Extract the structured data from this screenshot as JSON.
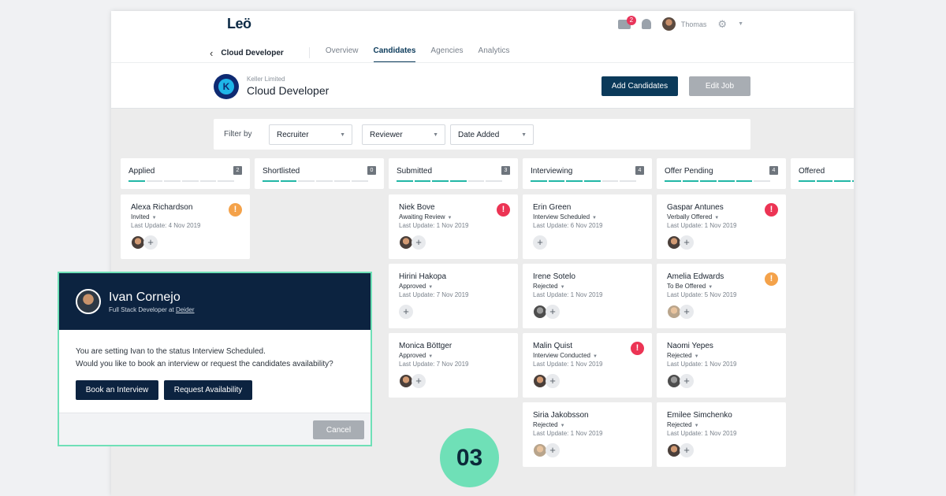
{
  "app": {
    "logo": "Leö",
    "mail_badge": "2",
    "user_name": "Thomas"
  },
  "nav": {
    "job": "Cloud Developer",
    "tabs": [
      "Overview",
      "Candidates",
      "Agencies",
      "Analytics"
    ],
    "active_tab": "Candidates"
  },
  "job": {
    "company_initial": "K",
    "company": "Keller Limited",
    "title": "Cloud Developer",
    "add_label": "Add Candidates",
    "edit_label": "Edit Job"
  },
  "filter": {
    "label": "Filter by",
    "selects": [
      "Recruiter",
      "Reviewer",
      "Date Added"
    ]
  },
  "columns": [
    {
      "title": "Applied",
      "count": "2",
      "progress": 0.1
    },
    {
      "title": "Shortlisted",
      "count": "0",
      "progress": 0.3
    },
    {
      "title": "Submitted",
      "count": "3",
      "progress": 0.6
    },
    {
      "title": "Interviewing",
      "count": "4",
      "progress": 0.6
    },
    {
      "title": "Offer Pending",
      "count": "4",
      "progress": 0.8
    },
    {
      "title": "Offered",
      "count": "",
      "progress": 0.8
    }
  ],
  "cards": {
    "applied": [
      {
        "name": "Alexa Richardson",
        "status": "Invited",
        "update": "Last Update: 4 Nov 2019",
        "alert": "!"
      }
    ],
    "submitted": [
      {
        "name": "Niek Bove",
        "status": "Awaiting Review",
        "update": "Last Update: 1 Nov 2019",
        "alert": "!"
      },
      {
        "name": "Hirini Hakopa",
        "status": "Approved",
        "update": "Last Update: 7 Nov 2019"
      },
      {
        "name": "Monica Böttger",
        "status": "Approved",
        "update": "Last Update: 7 Nov 2019"
      }
    ],
    "interviewing": [
      {
        "name": "Erin Green",
        "status": "Interview Scheduled",
        "update": "Last Update: 6 Nov 2019"
      },
      {
        "name": "Irene Sotelo",
        "status": "Rejected",
        "update": "Last Update: 1 Nov 2019"
      },
      {
        "name": "Malin Quist",
        "status": "Interview Conducted",
        "update": "Last Update: 1 Nov 2019",
        "alert": "!"
      },
      {
        "name": "Siria Jakobsson",
        "status": "Rejected",
        "update": "Last Update: 1 Nov 2019"
      }
    ],
    "offer_pending": [
      {
        "name": "Gaspar Antunes",
        "status": "Verbally Offered",
        "update": "Last Update: 1 Nov 2019",
        "alert": "!"
      },
      {
        "name": "Amelia Edwards",
        "status": "To Be Offered",
        "update": "Last Update: 5 Nov 2019",
        "alert": "!"
      },
      {
        "name": "Naomi Yepes",
        "status": "Rejected",
        "update": "Last Update: 1 Nov 2019"
      },
      {
        "name": "Emilee Simchenko",
        "status": "Rejected",
        "update": "Last Update: 1 Nov 2019"
      }
    ]
  },
  "modal": {
    "name": "Ivan Cornejo",
    "subtitle": "Full Stack Developer at",
    "company": "Deider",
    "line1": "You are setting Ivan to the status Interview Scheduled.",
    "line2": "Would you like to book an interview or request the candidates availability?",
    "book_label": "Book an Interview",
    "request_label": "Request Availability",
    "cancel_label": "Cancel"
  },
  "step": "03",
  "colors": {
    "navy": "#0c2340",
    "accent": "#6fe0b7",
    "teal_progress": "#22b7a6",
    "alert_red": "#ec3454",
    "alert_orange": "#f4a24a"
  }
}
